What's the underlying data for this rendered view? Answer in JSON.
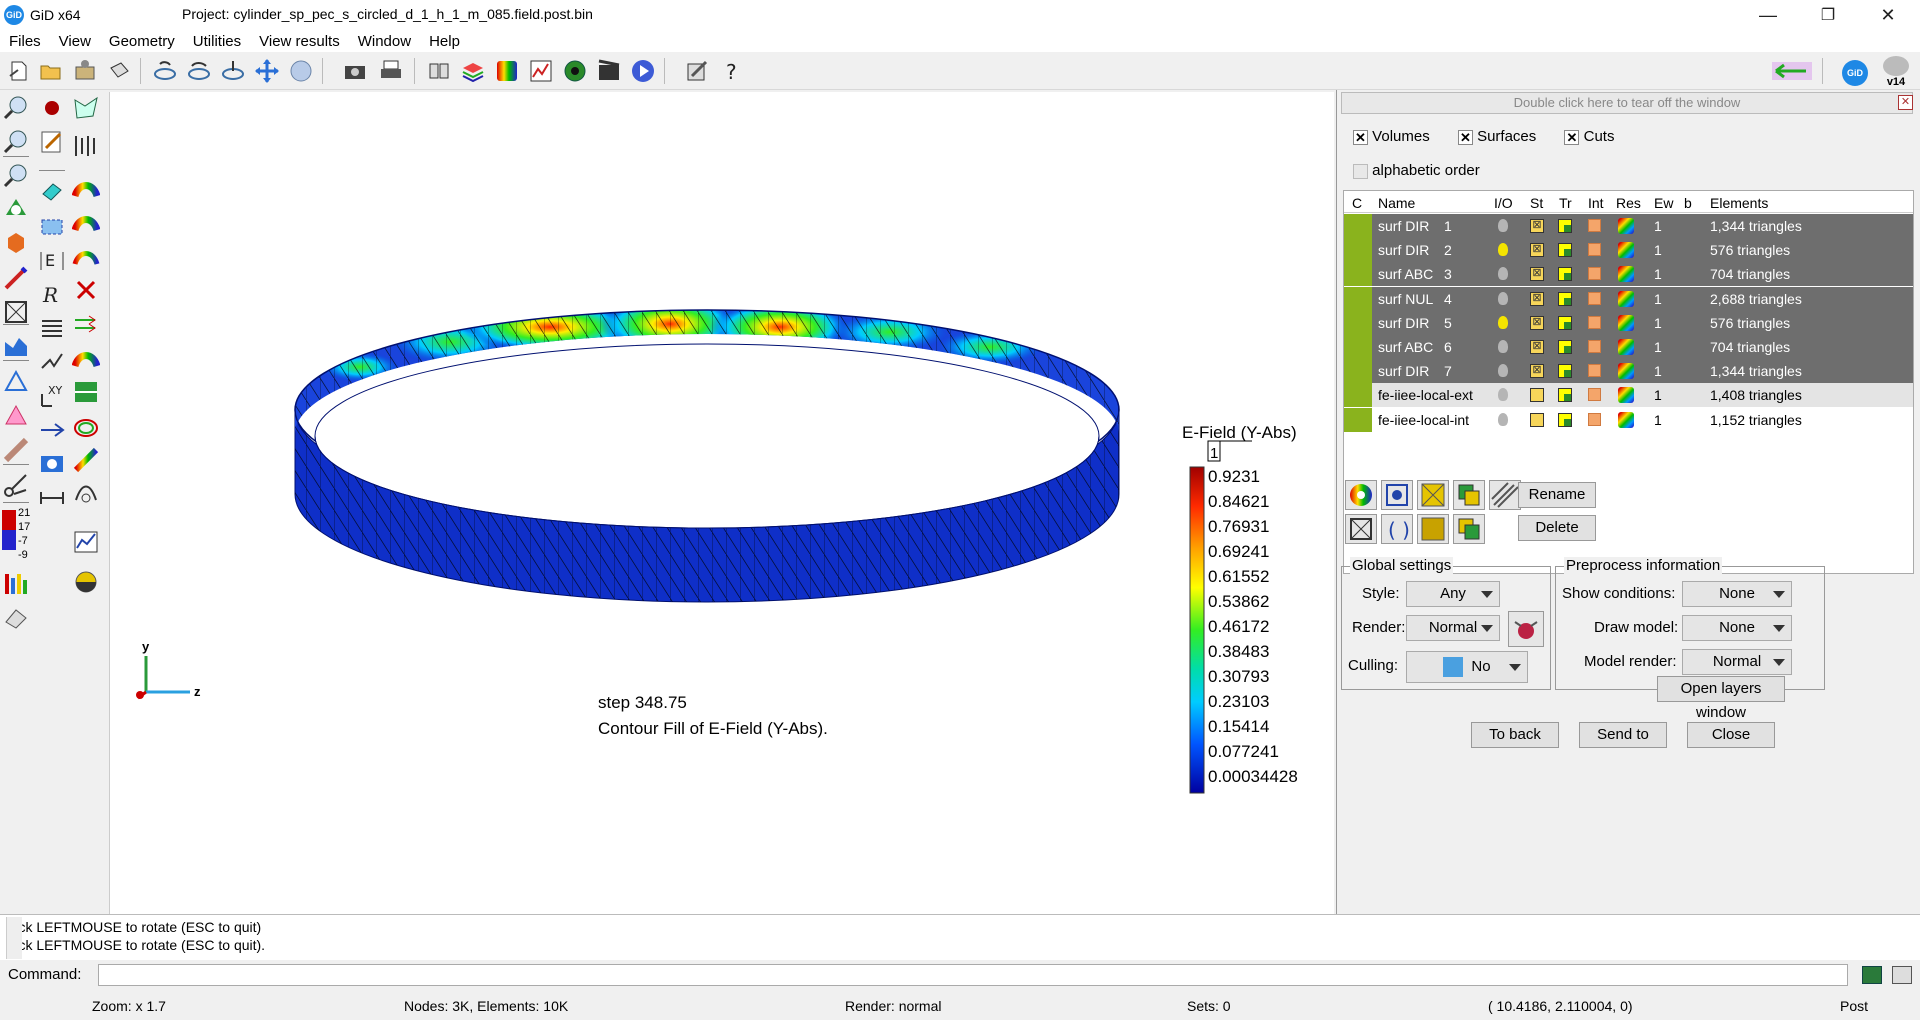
{
  "window": {
    "app_name": "GiD x64",
    "title": "Project: cylinder_sp_pec_s_circled_d_1_h_1_m_085.field.post.bin",
    "minimize": "—",
    "restore": "❐",
    "close": "✕"
  },
  "menu": [
    "Files",
    "View",
    "Geometry",
    "Utilities",
    "View results",
    "Window",
    "Help"
  ],
  "toolbar": {
    "version_badge": "v14",
    "gid_badge": "GiD"
  },
  "left_tools": {
    "counters": [
      "21",
      "17",
      "-7",
      "-9"
    ]
  },
  "viewport": {
    "legend": {
      "title": "E-Field (Y-Abs)",
      "step_box": "1",
      "values": [
        "0.9231",
        "0.84621",
        "0.76931",
        "0.69241",
        "0.61552",
        "0.53862",
        "0.46172",
        "0.38483",
        "0.30793",
        "0.23103",
        "0.15414",
        "0.077241",
        "0.00034428"
      ]
    },
    "step_text": "step 348.75",
    "caption": "Contour Fill of E-Field (Y-Abs).",
    "axes": {
      "y": "y",
      "z": "z"
    }
  },
  "panel": {
    "tearoff": "Double click here to tear off the window",
    "filters": [
      {
        "label": "Volumes",
        "checked": true
      },
      {
        "label": "Surfaces",
        "checked": true
      },
      {
        "label": "Cuts",
        "checked": true
      }
    ],
    "alphabetic": {
      "label": "alphabetic order",
      "checked": false
    },
    "columns": [
      "C",
      "Name",
      "I/O",
      "St",
      "Tr",
      "Int",
      "Res",
      "Ew",
      "b",
      "Elements"
    ],
    "rows": [
      {
        "name": "surf DIR",
        "num": "1",
        "ew": "1",
        "elements": "1,344 triangles",
        "sel": true,
        "bulb": "gray"
      },
      {
        "name": "surf DIR",
        "num": "2",
        "ew": "1",
        "elements": "576 triangles",
        "sel": true,
        "bulb": "yellow"
      },
      {
        "name": "surf ABC",
        "num": "3",
        "ew": "1",
        "elements": "704 triangles",
        "sel": true,
        "bulb": "gray"
      },
      {
        "name": "surf NUL",
        "num": "4",
        "ew": "1",
        "elements": "2,688 triangles",
        "sel": true,
        "bulb": "gray"
      },
      {
        "name": "surf DIR",
        "num": "5",
        "ew": "1",
        "elements": "576 triangles",
        "sel": true,
        "bulb": "yellow"
      },
      {
        "name": "surf ABC",
        "num": "6",
        "ew": "1",
        "elements": "704 triangles",
        "sel": true,
        "bulb": "gray"
      },
      {
        "name": "surf DIR",
        "num": "7",
        "ew": "1",
        "elements": "1,344 triangles",
        "sel": true,
        "bulb": "gray"
      },
      {
        "name": "fe-iiee-local-ext",
        "num": "",
        "ew": "1",
        "elements": "1,408 triangles",
        "sel": false,
        "light": true,
        "bulb": "gray"
      },
      {
        "name": "fe-iiee-local-int",
        "num": "",
        "ew": "1",
        "elements": "1,152 triangles",
        "sel": false,
        "light": false,
        "bulb": "gray"
      }
    ],
    "rename": "Rename",
    "delete": "Delete",
    "global": {
      "title": "Global settings",
      "style_label": "Style:",
      "style_value": "Any",
      "render_label": "Render:",
      "render_value": "Normal",
      "culling_label": "Culling:",
      "culling_value": "No"
    },
    "preproc": {
      "title": "Preprocess information",
      "show_cond_label": "Show conditions:",
      "show_cond_value": "None",
      "draw_model_label": "Draw model:",
      "draw_model_value": "None",
      "model_render_label": "Model render:",
      "model_render_value": "Normal",
      "open_layers": "Open layers window"
    },
    "to_back": "To back",
    "send_to": "Send to",
    "close": "Close"
  },
  "console": {
    "lines": [
      "Pick LEFTMOUSE to rotate (ESC to quit)",
      "Pick LEFTMOUSE to rotate (ESC to quit)."
    ],
    "command_label": "Command:"
  },
  "status": {
    "zoom": "Zoom: x 1.7",
    "nodes": "Nodes: 3K, Elements: 10K",
    "render": "Render: normal",
    "sets": "Sets: 0",
    "coords": "( 10.4186,  2.110004,  0)",
    "mode": "Post"
  }
}
